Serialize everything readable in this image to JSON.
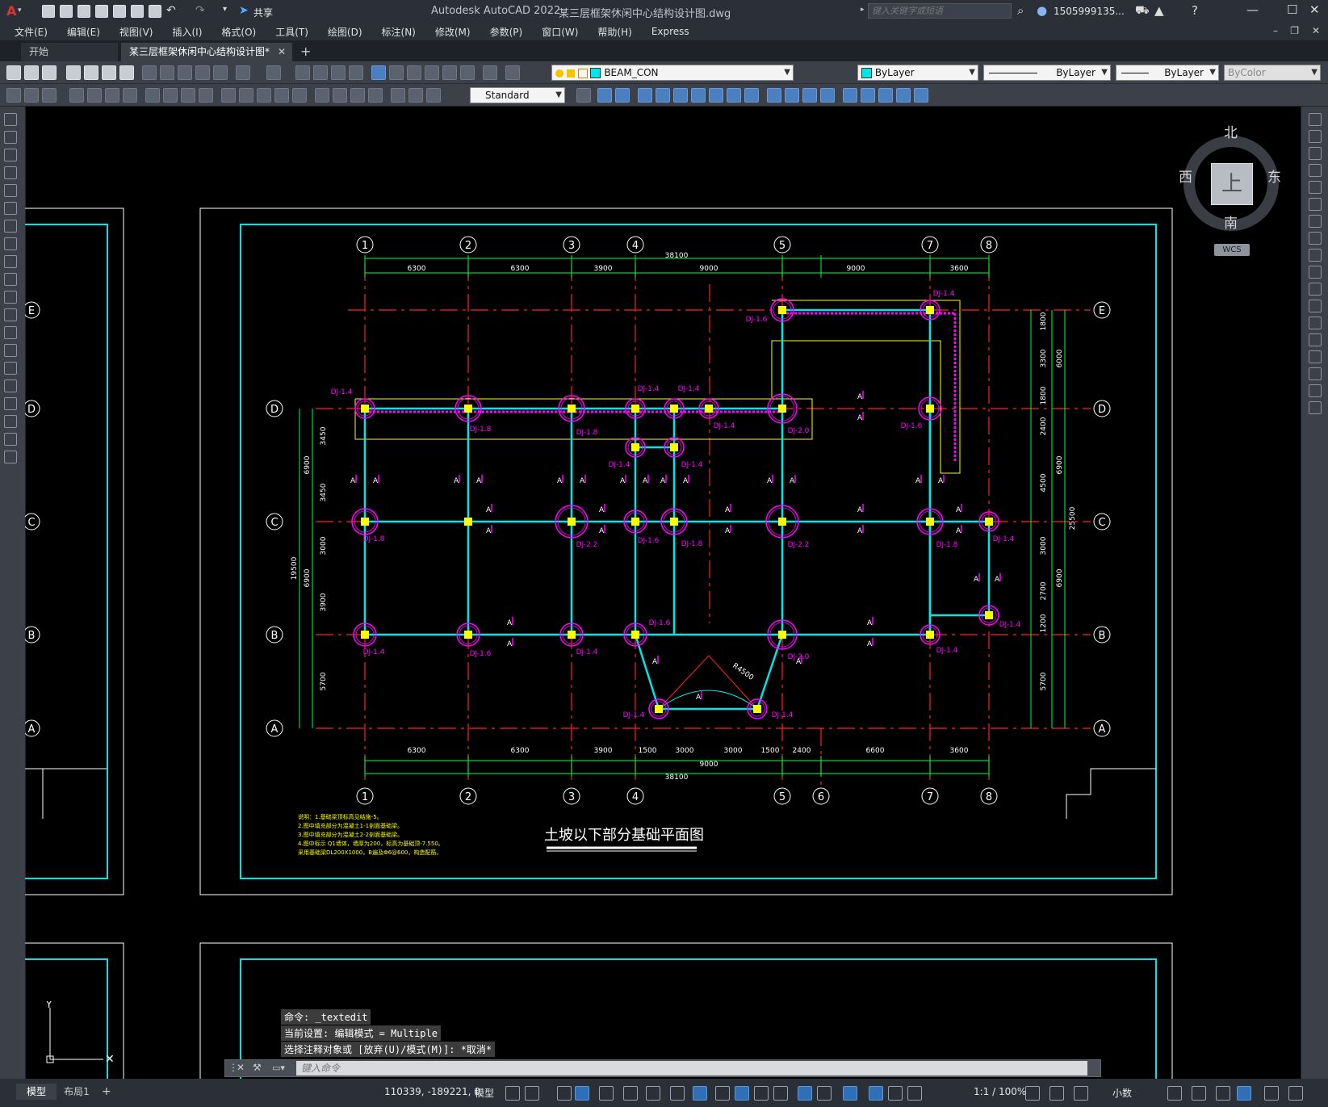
{
  "app": {
    "logo": "A",
    "title": "Autodesk AutoCAD 2022",
    "filename": "某三层框架休闲中心结构设计图.dwg",
    "share_label": "共享",
    "search_placeholder": "键入关键字或短语",
    "user": "1505999135..."
  },
  "menu": [
    "文件(E)",
    "编辑(E)",
    "视图(V)",
    "插入(I)",
    "格式(O)",
    "工具(T)",
    "绘图(D)",
    "标注(N)",
    "修改(M)",
    "参数(P)",
    "窗口(W)",
    "帮助(H)",
    "Express"
  ],
  "tabs": {
    "start": "开始",
    "active": "某三层框架休闲中心结构设计图*"
  },
  "toolbar": {
    "layer": "BEAM_CON",
    "color": "ByLayer",
    "linetype": "ByLayer",
    "lineweight": "ByLayer",
    "plotstyle": "ByColor",
    "textstyle": "Standard"
  },
  "viewcube": {
    "north": "北",
    "south": "南",
    "east": "东",
    "west": "西",
    "top": "上",
    "wcs": "WCS"
  },
  "drawing": {
    "title": "土坡以下部分基础平面图",
    "axes_numbers": [
      "1",
      "2",
      "3",
      "4",
      "5",
      "6",
      "7",
      "8"
    ],
    "axes_letters": [
      "E",
      "D",
      "C",
      "B",
      "A"
    ],
    "top_dims": [
      "6300",
      "6300",
      "3900",
      "9000",
      "9000",
      "3600"
    ],
    "top_total": "38100",
    "bottom_dims": [
      "6300",
      "6300",
      "3900",
      "1500",
      "3000",
      "3000",
      "1500",
      "2400",
      "6600",
      "3600"
    ],
    "bottom_sub": "9000",
    "bottom_total": "38100",
    "left_dims": [
      "3450",
      "3450",
      "3000",
      "3900",
      "5700"
    ],
    "left_mid": [
      "6900",
      "6900"
    ],
    "left_total": "19500",
    "right_dims": [
      "1800",
      "3300",
      "1800",
      "2400",
      "4500",
      "3000",
      "2700",
      "1200",
      "5700"
    ],
    "right_mid": [
      "6000",
      "6900",
      "6900"
    ],
    "right_total": "25500",
    "radius_label": "R4500",
    "footing_labels": [
      {
        "t": "DJ-1.4",
        "col": "1",
        "row": "D"
      },
      {
        "t": "DJ-1.8",
        "col": "2",
        "row": "D"
      },
      {
        "t": "DJ-1.8",
        "col": "3",
        "row": "D"
      },
      {
        "t": "DJ-1.4",
        "col": "4",
        "row": "D"
      },
      {
        "t": "DJ-1.4",
        "col": "4a",
        "row": "D"
      },
      {
        "t": "DJ-1.4",
        "col": "4b",
        "row": "D"
      },
      {
        "t": "DJ-2.0",
        "col": "5",
        "row": "D"
      },
      {
        "t": "DJ-1.6",
        "col": "7",
        "row": "D"
      },
      {
        "t": "DJ-1.6",
        "col": "5",
        "row": "E"
      },
      {
        "t": "DJ-1.4",
        "col": "7",
        "row": "E"
      },
      {
        "t": "DJ-1.4",
        "col": "4",
        "row": "Dd"
      },
      {
        "t": "DJ-1.4",
        "col": "4a",
        "row": "Dd"
      },
      {
        "t": "DJ-1.8",
        "col": "1",
        "row": "C"
      },
      {
        "t": "DJ-2.2",
        "col": "3",
        "row": "C"
      },
      {
        "t": "DJ-1.6",
        "col": "4",
        "row": "C"
      },
      {
        "t": "DJ-1.8",
        "col": "4a",
        "row": "C"
      },
      {
        "t": "DJ-2.2",
        "col": "5",
        "row": "C"
      },
      {
        "t": "DJ-1.8",
        "col": "7",
        "row": "C"
      },
      {
        "t": "DJ-1.4",
        "col": "8",
        "row": "C"
      },
      {
        "t": "DJ-1.4",
        "col": "1",
        "row": "B"
      },
      {
        "t": "DJ-1.6",
        "col": "2",
        "row": "B"
      },
      {
        "t": "DJ-1.4",
        "col": "3",
        "row": "B"
      },
      {
        "t": "DJ-1.6",
        "col": "4",
        "row": "B"
      },
      {
        "t": "DJ-2.0",
        "col": "5",
        "row": "B"
      },
      {
        "t": "DJ-1.4",
        "col": "7",
        "row": "B"
      },
      {
        "t": "DJ-1.4",
        "col": "8",
        "row": "Bb"
      },
      {
        "t": "DJ-1.4",
        "col": "4",
        "row": "A"
      },
      {
        "t": "DJ-1.4",
        "col": "5",
        "row": "A"
      }
    ],
    "notes": [
      "说明：1.基础梁顶标高见结施-5。",
      "2.图中填充部分为混凝土1-1剖面基础梁。",
      "3.图中填充部分为混凝土2-2剖面基础梁。",
      "4.图中标示 Q1墙体，墙厚为200，标高为基础顶-7.550。",
      "采用基础梁DL200X1000，B遍及Φ6@600，构造配筋。"
    ]
  },
  "command": {
    "history": [
      "命令: _textedit",
      "当前设置: 编辑模式 = Multiple",
      "选择注释对象或 [放弃(U)/模式(M)]: *取消*"
    ],
    "placeholder": "键入命令"
  },
  "status": {
    "coords": "110339, -189221, 0",
    "model": "模型",
    "scale": "1:1 / 100%",
    "units": "小数",
    "layout_tabs": [
      "模型",
      "布局1"
    ]
  },
  "colors": {
    "cyan": "#00e5e5",
    "red": "#ff2020",
    "green": "#00ff33",
    "magenta": "#ff00ff",
    "yellow": "#ffff00",
    "white": "#ffffff"
  }
}
